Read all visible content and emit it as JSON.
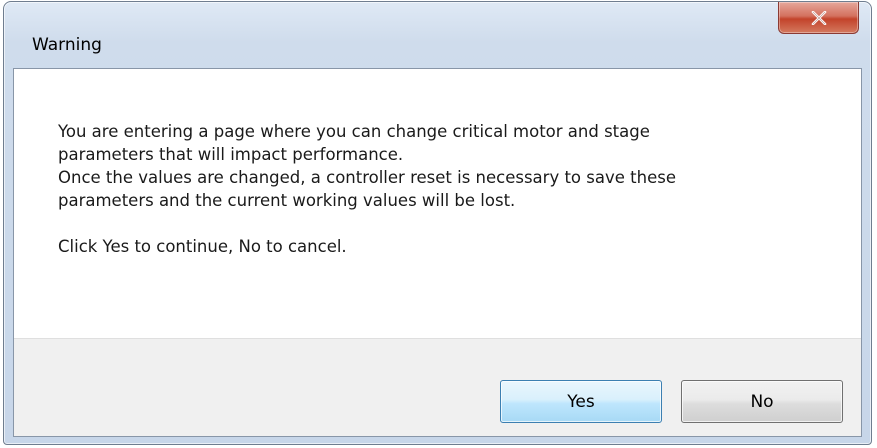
{
  "window": {
    "title": "Warning",
    "close_glyph": "X"
  },
  "message": {
    "lines": [
      "You are entering a page where you can change critical motor and stage",
      "parameters that will impact performance.",
      "Once the values are changed, a controller reset is necessary to save these",
      "parameters and the current working values will be lost."
    ],
    "prompt": "Click Yes to continue, No to cancel."
  },
  "buttons": {
    "yes_label": "Yes",
    "no_label": "No"
  },
  "colors": {
    "close_button": "#c7503a",
    "default_button_border": "#3c7fb1",
    "button_bar": "#f0f0f0"
  }
}
